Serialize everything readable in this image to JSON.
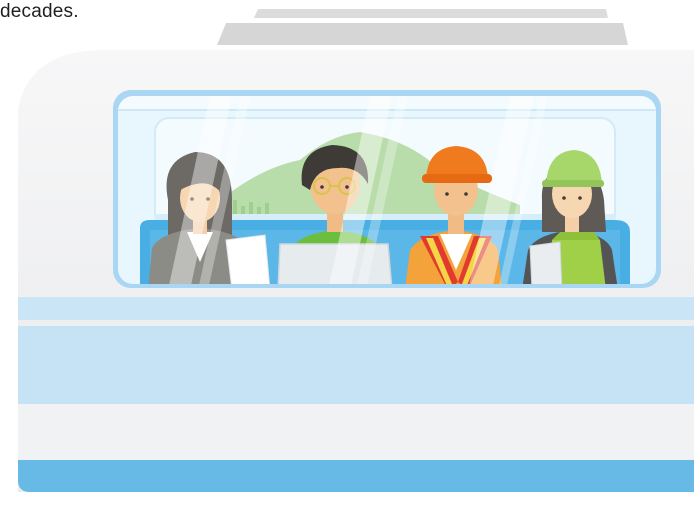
{
  "caption": {
    "text": "decades."
  },
  "illustration": {
    "subject": "train-car-with-passengers",
    "passengers": [
      {
        "role": "office-worker",
        "items": [
          "document"
        ]
      },
      {
        "role": "engineer",
        "items": [
          "laptop",
          "glasses"
        ]
      },
      {
        "role": "construction-worker",
        "items": [
          "hard-hat",
          "safety-vest"
        ]
      },
      {
        "role": "field-worker",
        "items": [
          "helmet",
          "clipboard",
          "apron"
        ]
      }
    ],
    "colors": {
      "train_body": "#f3f4f6",
      "train_shadow": "#d7d8da",
      "roof": "#d9d9d9",
      "stripe_light": "#c5e3f5",
      "stripe_dark": "#67b9e6",
      "window_frame": "#a9d6f2",
      "window_glass": "#e8f6fd",
      "seat": "#49aee3",
      "mountain": "#b8dcaa"
    }
  }
}
